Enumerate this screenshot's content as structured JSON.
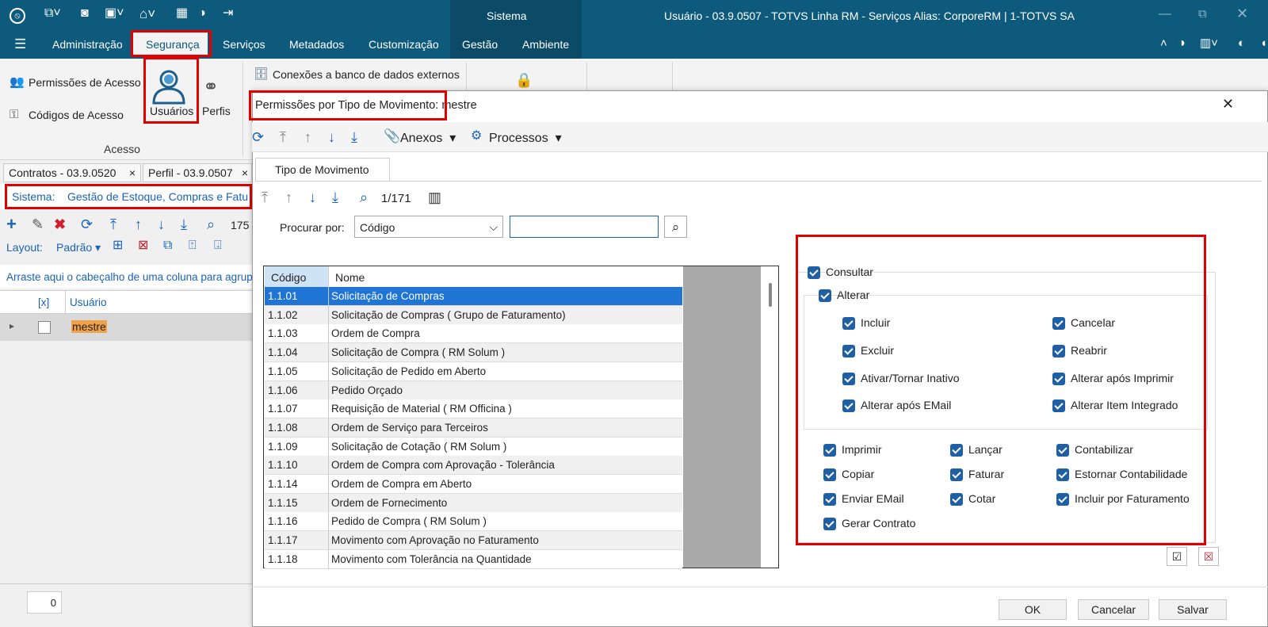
{
  "app": {
    "system_label": "Sistema",
    "window_title": "Usuário - 03.9.0507 - TOTVS Linha RM - Serviços  Alias: CorporeRM | 1-TOTVS SA"
  },
  "ribbon": {
    "tabs": [
      "Administração",
      "Segurança",
      "Serviços",
      "Metadados",
      "Customização",
      "Gestão",
      "Ambiente"
    ],
    "permissoes_acesso": "Permissões de Acesso",
    "codigos_acesso": "Códigos de Acesso",
    "usuarios": "Usuários",
    "perfis": "Perfis",
    "conexoes": "Conexões a banco de dados externos",
    "group_acesso": "Acesso"
  },
  "left": {
    "doc_tabs": [
      "Contratos - 03.9.0520",
      "Perfil - 03.9.0507"
    ],
    "sistema_label": "Sistema:",
    "sistema_value": "Gestão de Estoque, Compras e Fatu",
    "count_partial": "175",
    "layout_label": "Layout:",
    "layout_value": "Padrão",
    "group_hint": "Arraste aqui o cabeçalho de uma coluna para agrup",
    "col_x": "[x]",
    "col_usuario": "Usuário",
    "row_user": "mestre",
    "footer_value": "0"
  },
  "dialog": {
    "title": "Permissões por Tipo de Movimento: mestre",
    "anexos": "Anexos",
    "processos": "Processos",
    "tab": "Tipo de Movimento",
    "record_pos": "1/171",
    "search_label": "Procurar por:",
    "search_field": "Código",
    "search_value": "",
    "columns": [
      "Código",
      "Nome"
    ],
    "rows": [
      [
        "1.1.01",
        "Solicitação de Compras"
      ],
      [
        "1.1.02",
        "Solicitação de Compras ( Grupo de Faturamento)"
      ],
      [
        "1.1.03",
        "Ordem de Compra"
      ],
      [
        "1.1.04",
        "Solicitação de Compra  ( RM Solum )"
      ],
      [
        "1.1.05",
        "Solicitação de Pedido em Aberto"
      ],
      [
        "1.1.06",
        "Pedido Orçado"
      ],
      [
        "1.1.07",
        "Requisição de Material ( RM Officina )"
      ],
      [
        "1.1.08",
        "Ordem de Serviço para Terceiros"
      ],
      [
        "1.1.09",
        "Solicitação de Cotação  ( RM Solum )"
      ],
      [
        "1.1.10",
        "Ordem de Compra com Aprovação - Tolerância"
      ],
      [
        "1.1.14",
        "Ordem de Compra em Aberto"
      ],
      [
        "1.1.15",
        "Ordem de Fornecimento"
      ],
      [
        "1.1.16",
        "Pedido de Compra  ( RM Solum )"
      ],
      [
        "1.1.17",
        "Movimento com Aprovação no Faturamento"
      ],
      [
        "1.1.18",
        "Movimento com Tolerância na Quantidade"
      ]
    ],
    "consultar": "Consultar",
    "alterar": "Alterar",
    "alterar_opts": [
      "Incluir",
      "Cancelar",
      "Excluir",
      "Reabrir",
      "Ativar/Tornar Inativo",
      "Alterar após Imprimir",
      "Alterar após EMail",
      "Alterar Item Integrado"
    ],
    "other_opts": [
      "Imprimir",
      "Lançar",
      "Contabilizar",
      "Copiar",
      "Faturar",
      "Estornar Contabilidade",
      "Enviar EMail",
      "Cotar",
      "Incluir por Faturamento",
      "Gerar Contrato"
    ],
    "ok": "OK",
    "cancelar": "Cancelar",
    "salvar": "Salvar"
  },
  "colors": {
    "titlebar": "#0e5a7c",
    "checkbox": "#1f5fa6",
    "selection": "#1f74d4",
    "highlight_box": "#e10000"
  }
}
